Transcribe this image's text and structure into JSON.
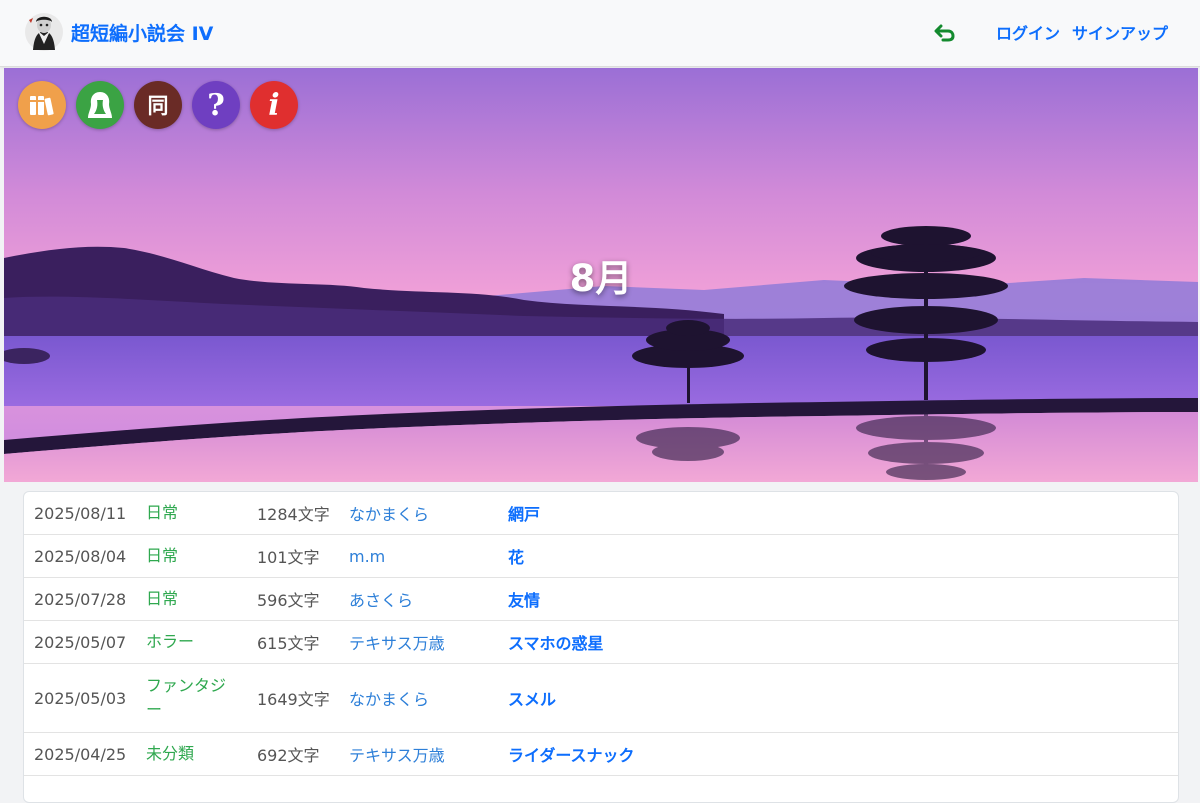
{
  "header": {
    "brand": "超短編小説会 IV",
    "login": "ログイン",
    "signup": "サインアップ"
  },
  "hero": {
    "title": "8月",
    "icons": [
      {
        "name": "books-icon",
        "color": "#f0a04b"
      },
      {
        "name": "profile-icon",
        "color": "#3ba344"
      },
      {
        "name": "dou-icon",
        "glyph": "同",
        "color": "#6a2b26"
      },
      {
        "name": "help-icon",
        "glyph": "?",
        "color": "#6f3fc1"
      },
      {
        "name": "info-icon",
        "glyph": "i",
        "color": "#e02f2f"
      }
    ]
  },
  "posts": [
    {
      "date": "2025/08/11",
      "genre": "日常",
      "chars": "1284文字",
      "author": "なかまくら",
      "title": "網戸"
    },
    {
      "date": "2025/08/04",
      "genre": "日常",
      "chars": "101文字",
      "author": "m.m",
      "title": "花"
    },
    {
      "date": "2025/07/28",
      "genre": "日常",
      "chars": "596文字",
      "author": "あさくら",
      "title": "友情"
    },
    {
      "date": "2025/05/07",
      "genre": "ホラー",
      "chars": "615文字",
      "author": "テキサス万歳",
      "title": "スマホの惑星"
    },
    {
      "date": "2025/05/03",
      "genre": "ファンタジー",
      "chars": "1649文字",
      "author": "なかまくら",
      "title": "スメル"
    },
    {
      "date": "2025/04/25",
      "genre": "未分類",
      "chars": "692文字",
      "author": "テキサス万歳",
      "title": "ライダースナック"
    }
  ]
}
